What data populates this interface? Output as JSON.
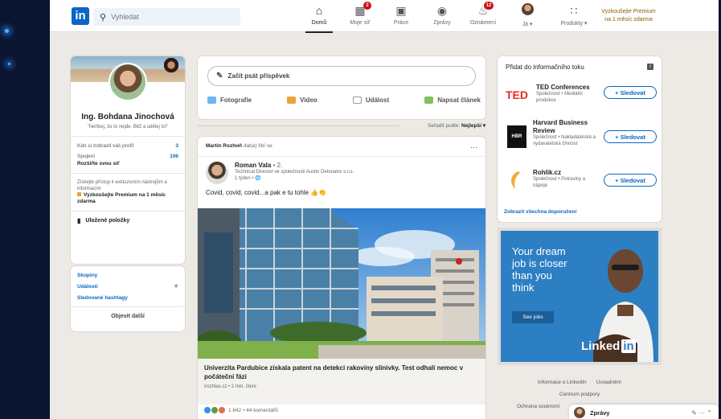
{
  "header": {
    "logo": "in",
    "search_placeholder": "Vyhledat",
    "nav": [
      {
        "label": "Domů",
        "badge": ""
      },
      {
        "label": "Moje síť",
        "badge": "2"
      },
      {
        "label": "Práce",
        "badge": ""
      },
      {
        "label": "Zprávy",
        "badge": ""
      },
      {
        "label": "Oznámení",
        "badge": "12"
      },
      {
        "label": "Já ▾",
        "badge": ""
      },
      {
        "label": "Produkty ▾",
        "badge": ""
      }
    ],
    "premium_line1": "Vyzkoušejte Premium",
    "premium_line2": "na 1 měsíc zdarma"
  },
  "profile": {
    "name": "Ing. Bohdana Jinochová",
    "tagline": "\"Neříkej, že to nejde. Běž a udělej to!\"",
    "viewers_label": "Kdo si zobrazil váš profil",
    "viewers_value": "3",
    "connections_label": "Spojení",
    "connections_value": "106",
    "connections_sub": "Rozšiřte svou síť",
    "premium_desc": "Získejte přístup k exkluzivním nástrojům a informacím",
    "premium_cta": "Vyzkoušejte Premium na 1 měsíc zdarma",
    "saved_items": "Uložené položky"
  },
  "groups": {
    "groups": "Skupiny",
    "events": "Události",
    "hashtags": "Sledované hashtagy",
    "discover": "Objevit další",
    "plus": "+"
  },
  "compose": {
    "start_post": "Začít psát příspěvek",
    "photo": "Fotografie",
    "video": "Video",
    "event": "Událost",
    "article": "Napsat článek",
    "sort_label": "Seřadit podle:",
    "sort_value": "Nejlepší ▾"
  },
  "post": {
    "liker": "Martin Rozhoň",
    "liked_text": "dal(a) líbí se",
    "menu": "···",
    "author": "Roman Vala",
    "degree": "• 2.",
    "author_title": "Technical Director ve společnosti Austin Detonator s.r.o.",
    "time": "1 týden • 🌐",
    "text": "Covid, covid, covid...a pak e tu tohle 👍👏",
    "link_title": "Univerzita Pardubice získala patent na detekci rakoviny slinivky. Test odhalí nemoc v počáteční fázi",
    "link_source": "irozhlas.cz • 2 min. čtení",
    "reactions": "1 842 • 44 komentářů"
  },
  "feed": {
    "title": "Přidat do informačního toku",
    "info": "i",
    "follow_label": "+ Sledovat",
    "suggestions": [
      {
        "logo": "TED",
        "name": "TED Conferences",
        "desc": "Společnost • Mediální produkce"
      },
      {
        "logo": "HBR",
        "name": "Harvard Business Review",
        "desc": "Společnost • Nakladatelská a vydavatelská činnost"
      },
      {
        "logo": "",
        "name": "Rohlik.cz",
        "desc": "Společnost • Potraviny a nápoje"
      }
    ],
    "more": "Zobrazit všechna doporučení"
  },
  "ad": {
    "text": "Your dream job is closer than you think",
    "button": "See jobs",
    "brand": "Linked",
    "brand_in": "in"
  },
  "footer": {
    "about": "Informace o LinkedIn",
    "accessibility": "Usnadnění",
    "help": "Centrum podpory",
    "privacy": "Ochrana soukromí"
  },
  "messaging": {
    "label": "Zprávy",
    "icons": "✎ ··· ⌃"
  },
  "colors": {
    "linkedin_blue": "#0a66c2",
    "premium_gold": "#915907",
    "ted_red": "#e62b1e",
    "ad_blue": "#2c7fc3"
  }
}
